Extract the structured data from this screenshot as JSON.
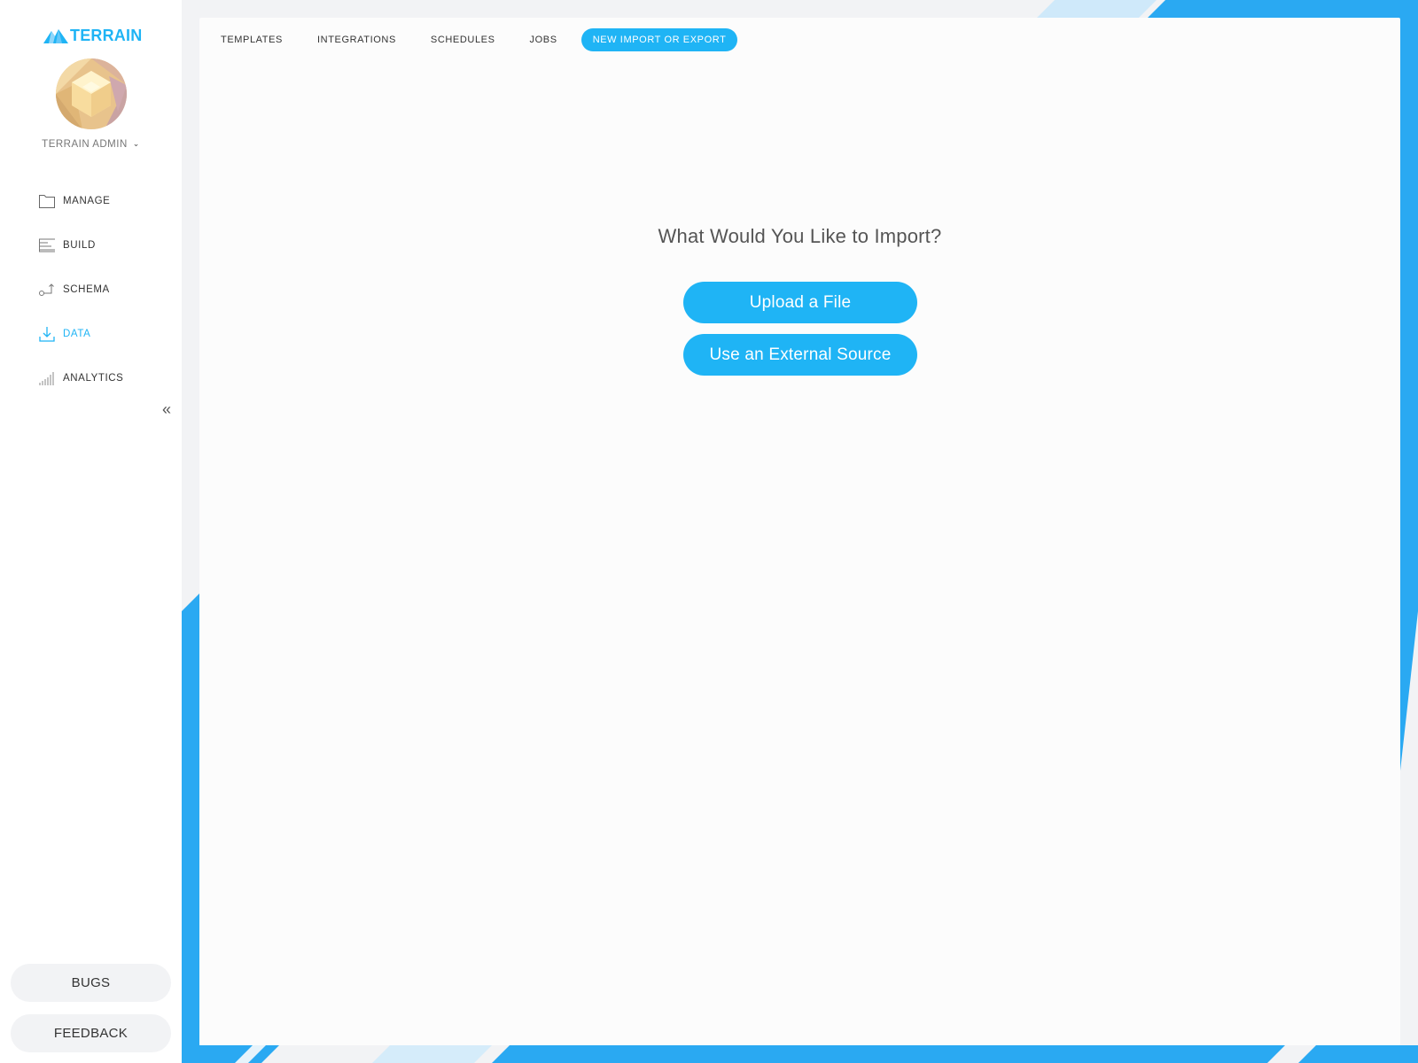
{
  "app": {
    "brand": "TERRAIN",
    "accent_color": "#1fb4f5"
  },
  "sidebar": {
    "user_name": "TERRAIN ADMIN",
    "user_menu_icon": "chevron-down-icon",
    "items": [
      {
        "label": "MANAGE",
        "icon": "folder-icon",
        "active": false
      },
      {
        "label": "BUILD",
        "icon": "list-icon",
        "active": false
      },
      {
        "label": "SCHEMA",
        "icon": "schema-icon",
        "active": false
      },
      {
        "label": "DATA",
        "icon": "download-icon",
        "active": true
      },
      {
        "label": "ANALYTICS",
        "icon": "bar-chart-icon",
        "active": false
      }
    ],
    "collapse_icon": "double-chevron-left-icon",
    "collapse_label": "«",
    "bugs_label": "BUGS",
    "feedback_label": "FEEDBACK"
  },
  "tabs": [
    {
      "label": "TEMPLATES",
      "active": false
    },
    {
      "label": "INTEGRATIONS",
      "active": false
    },
    {
      "label": "SCHEDULES",
      "active": false
    },
    {
      "label": "JOBS",
      "active": false
    },
    {
      "label": "NEW IMPORT OR EXPORT",
      "active": true
    }
  ],
  "main": {
    "heading": "What Would You Like to Import?",
    "upload_label": "Upload a File",
    "external_label": "Use an External Source"
  }
}
